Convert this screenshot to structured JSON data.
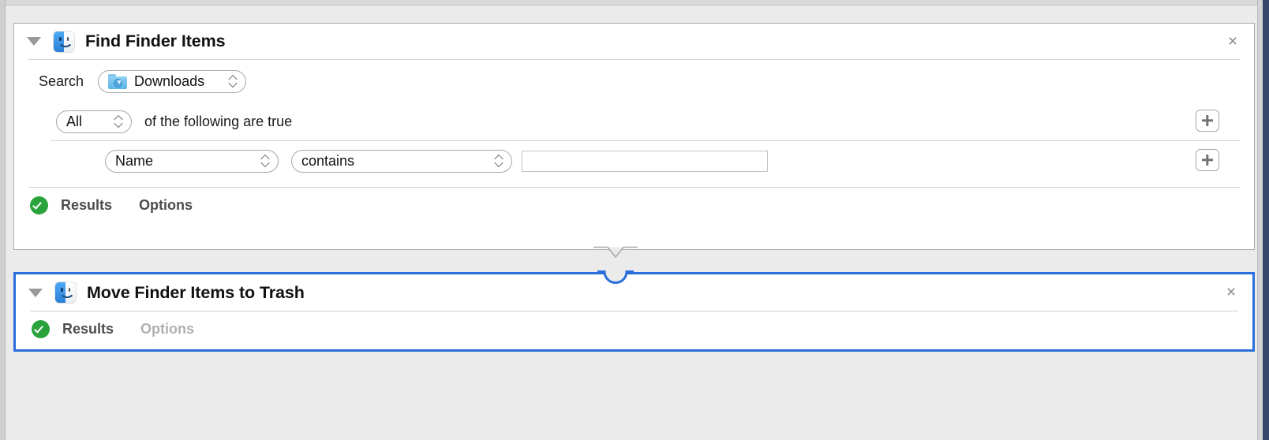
{
  "window": {
    "background_color": "#ebebeb",
    "frame_color": "#37476b"
  },
  "actions": [
    {
      "id": "find-finder-items",
      "title": "Find Finder Items",
      "icon": "finder-icon",
      "selected": false,
      "close_label": "×",
      "search": {
        "label": "Search",
        "popup_value": "Downloads",
        "popup_icon": "downloads-folder-icon"
      },
      "match": {
        "popup_value": "All",
        "trailing_text": "of the following are true",
        "add_button_label": "+"
      },
      "condition": {
        "attribute_value": "Name",
        "operator_value": "contains",
        "value": "",
        "placeholder": "",
        "add_button_label": "+"
      },
      "footer": {
        "status_icon": "green-check-icon",
        "results_label": "Results",
        "options_label": "Options",
        "options_disabled": false
      }
    },
    {
      "id": "move-finder-items-to-trash",
      "title": "Move Finder Items to Trash",
      "icon": "finder-icon",
      "selected": true,
      "close_label": "×",
      "footer": {
        "status_icon": "green-check-icon",
        "results_label": "Results",
        "options_label": "Options",
        "options_disabled": true
      }
    }
  ],
  "colors": {
    "selection_blue": "#2a6ddb",
    "status_green": "#2aa33d",
    "panel_border": "#aaaaaa",
    "divider": "#d2d2d2"
  }
}
